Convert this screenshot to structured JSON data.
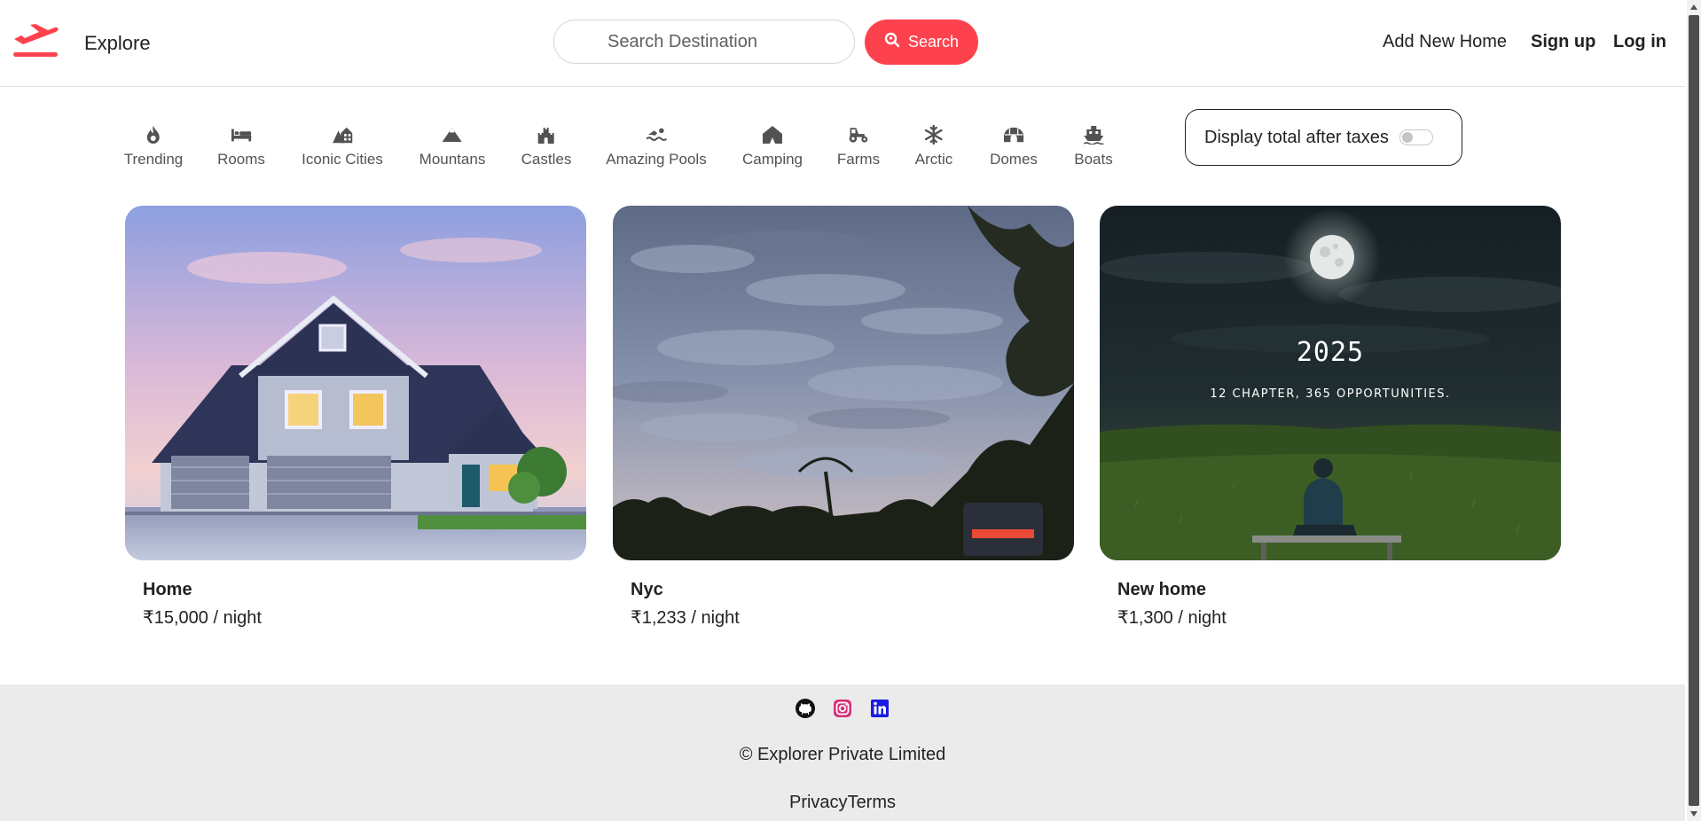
{
  "header": {
    "brand": "Explore",
    "search_placeholder": "Search Destination",
    "search_button": "Search",
    "add_home": "Add New Home",
    "signup": "Sign up",
    "login": "Log in",
    "accent_color": "#fe424d"
  },
  "filters": [
    {
      "label": "Trending",
      "icon": "fire-icon"
    },
    {
      "label": "Rooms",
      "icon": "bed-icon"
    },
    {
      "label": "Iconic Cities",
      "icon": "city-icon"
    },
    {
      "label": "Mountans",
      "icon": "mountain-icon"
    },
    {
      "label": "Castles",
      "icon": "castle-icon"
    },
    {
      "label": "Amazing Pools",
      "icon": "swimmer-icon"
    },
    {
      "label": "Camping",
      "icon": "tent-icon"
    },
    {
      "label": "Farms",
      "icon": "tractor-icon"
    },
    {
      "label": "Arctic",
      "icon": "snowflake-icon"
    },
    {
      "label": "Domes",
      "icon": "igloo-icon"
    },
    {
      "label": "Boats",
      "icon": "boat-icon"
    }
  ],
  "tax_toggle": {
    "label": "Display total after taxes",
    "checked": false
  },
  "listings": [
    {
      "title": "Home",
      "price": "₹15,000 / night",
      "image": "house-photo"
    },
    {
      "title": "Nyc",
      "price": "₹1,233 / night",
      "image": "cloudy-sky-photo"
    },
    {
      "title": "New home",
      "price": "₹1,300 / night",
      "image": "night-moon-photo",
      "image_year": "2025",
      "image_caption": "12 CHAPTER, 365 OPPORTUNITIES."
    }
  ],
  "footer": {
    "socials": [
      "github-icon",
      "instagram-icon",
      "linkedin-icon"
    ],
    "copyright": "© Explorer Private Limited",
    "privacy": "Privacy",
    "terms": "Terms"
  }
}
